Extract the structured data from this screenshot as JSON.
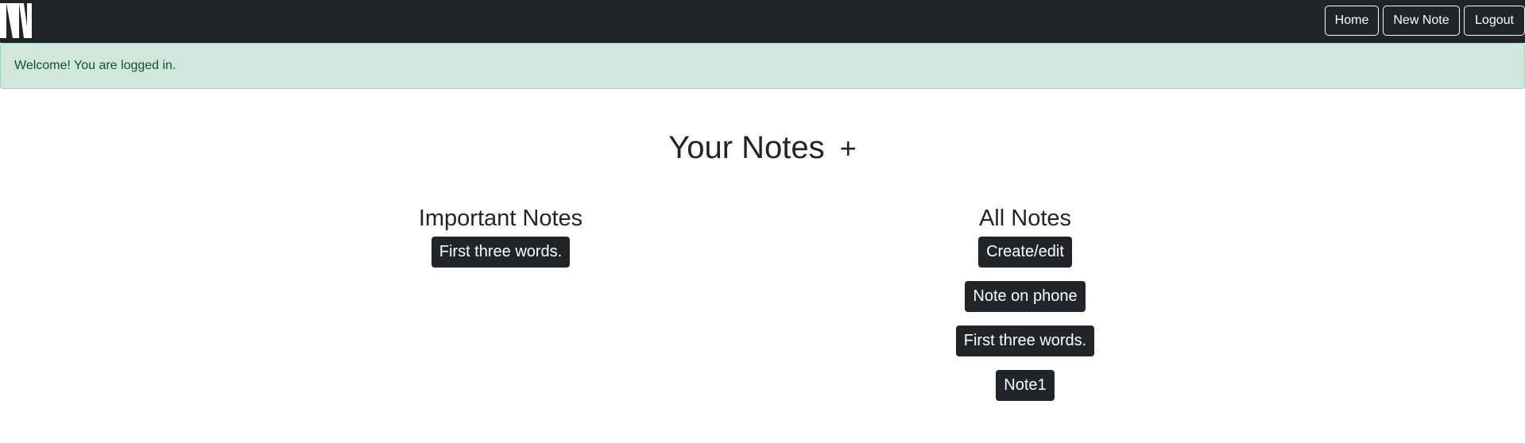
{
  "navbar": {
    "logo_icon": "nn-logo-icon",
    "buttons": {
      "home": "Home",
      "new_note": "New Note",
      "logout": "Logout"
    }
  },
  "alert": {
    "message": "Welcome! You are logged in.",
    "color": "#d1e7dd"
  },
  "main": {
    "title": "Your Notes",
    "add_symbol": "+",
    "important_notes": {
      "heading": "Important Notes",
      "notes": [
        "First three words."
      ]
    },
    "all_notes": {
      "heading": "All Notes",
      "notes": [
        "Create/edit",
        "Note on phone",
        "First three words.",
        "Note1"
      ]
    }
  },
  "colors": {
    "navbar_bg": "#212529",
    "note_button_bg": "#212529",
    "alert_text": "#0f5132"
  }
}
